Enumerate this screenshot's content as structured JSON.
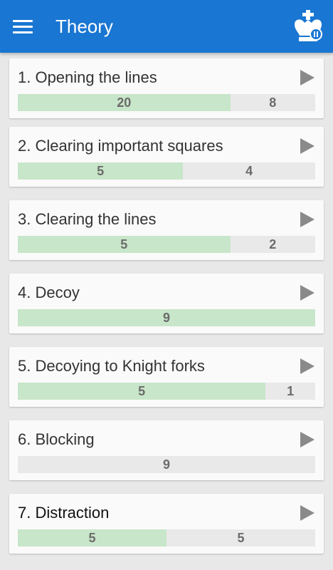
{
  "header": {
    "title": "Theory",
    "menu_icon": "hamburger-menu-icon",
    "logo_icon": "chess-king-logo-icon",
    "color": "#1976d2"
  },
  "progress_colors": {
    "completed": "#c8e6c9",
    "remaining": "#e9e9e9"
  },
  "lessons": [
    {
      "title": "1. Opening the lines",
      "completed": 20,
      "remaining": 8
    },
    {
      "title": "2. Clearing important squares",
      "completed": 5,
      "remaining": 4
    },
    {
      "title": "3. Clearing the lines",
      "completed": 5,
      "remaining": 2
    },
    {
      "title": "4. Decoy",
      "completed": 9,
      "remaining": 0
    },
    {
      "title": "5. Decoying to Knight forks",
      "completed": 5,
      "remaining": 1
    },
    {
      "title": "6. Blocking",
      "completed": 0,
      "remaining": 9
    },
    {
      "title": "7. Distraction",
      "completed": 5,
      "remaining": 5
    }
  ]
}
